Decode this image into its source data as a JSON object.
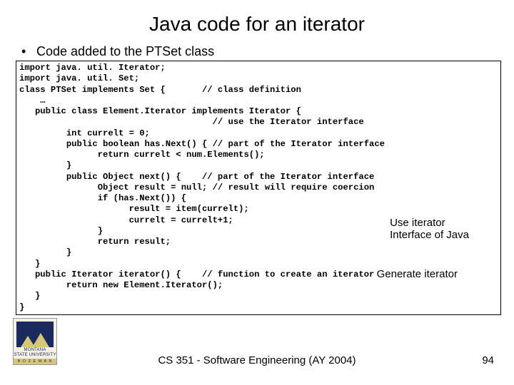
{
  "title": "Java code for an iterator",
  "bullet": "Code added to the PTSet class",
  "code": "import java. util. Iterator;\nimport java. util. Set;\nclass PTSet implements Set {       // class definition\n    …\n   public class Element.Iterator implements Iterator {\n                                     // use the Iterator interface\n         int currelt = 0;\n         public boolean has.Next() { // part of the Iterator interface\n               return currelt < num.Elements();\n         }\n         public Object next() {    // part of the Iterator interface\n               Object result = null; // result will require coercion\n               if (has.Next()) {\n                     result = item(currelt);\n                     currelt = currelt+1;\n               }\n               return result;\n         }\n   }\n   public Iterator iterator() {    // function to create an iterator\n         return new Element.Iterator();\n   }\n}",
  "callout1": "Use iterator\nInterface of Java",
  "callout2": "Generate iterator",
  "logo": {
    "line1": "MONTANA",
    "line2": "STATE UNIVERSITY",
    "line3": "B O Z E M A N"
  },
  "footer": "CS 351 - Software Engineering (AY 2004)",
  "page": "94"
}
